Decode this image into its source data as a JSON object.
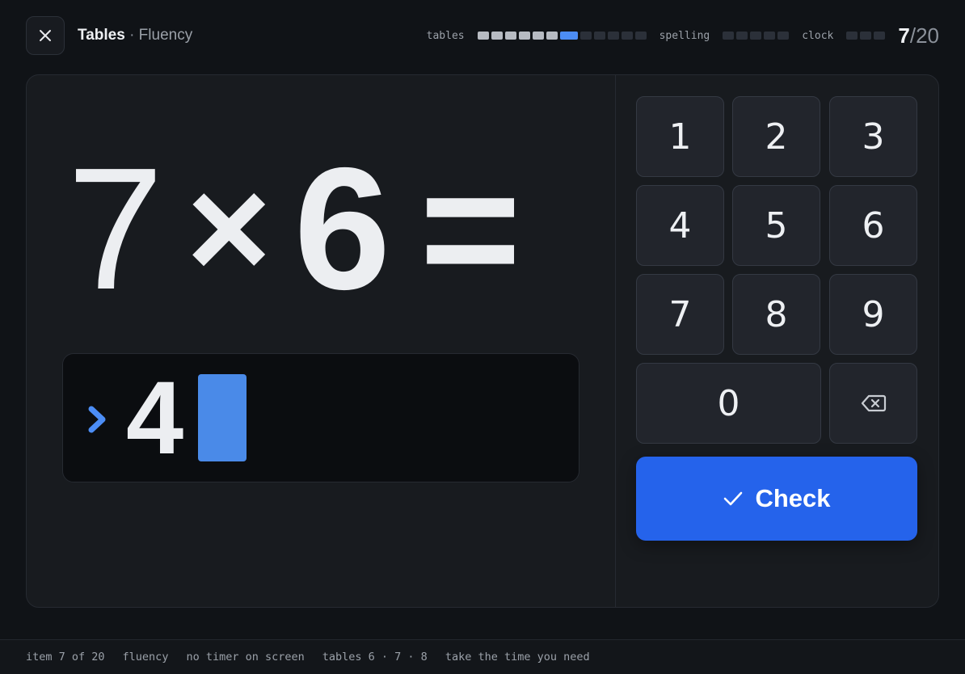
{
  "header": {
    "title": "Tables",
    "separator": "·",
    "subtitle": "Fluency",
    "progress": {
      "groups": [
        {
          "label": "tables",
          "segments": 12,
          "done": 6,
          "current_index": 6
        },
        {
          "label": "spelling",
          "segments": 5,
          "done": 0,
          "current_index": -1
        },
        {
          "label": "clock",
          "segments": 3,
          "done": 0,
          "current_index": -1
        }
      ],
      "current": "7",
      "separator": "/",
      "total": "20"
    }
  },
  "equation": {
    "a": "7",
    "operator": "×",
    "b": "6",
    "equals": "="
  },
  "answer": {
    "value": "4"
  },
  "keypad": {
    "keys": [
      "1",
      "2",
      "3",
      "4",
      "5",
      "6",
      "7",
      "8",
      "9",
      "0"
    ],
    "backspace_icon": "backspace-icon",
    "check_label": "Check"
  },
  "footer": {
    "item": "item 7 of 20",
    "mode": "fluency",
    "timer": "no timer on screen",
    "tables": "tables 6 · 7 · 8",
    "note": "take the time you need"
  },
  "colors": {
    "accent": "#2563eb",
    "caret": "#4a8ae8",
    "current_segment": "#4c8df5",
    "background": "#101317"
  }
}
